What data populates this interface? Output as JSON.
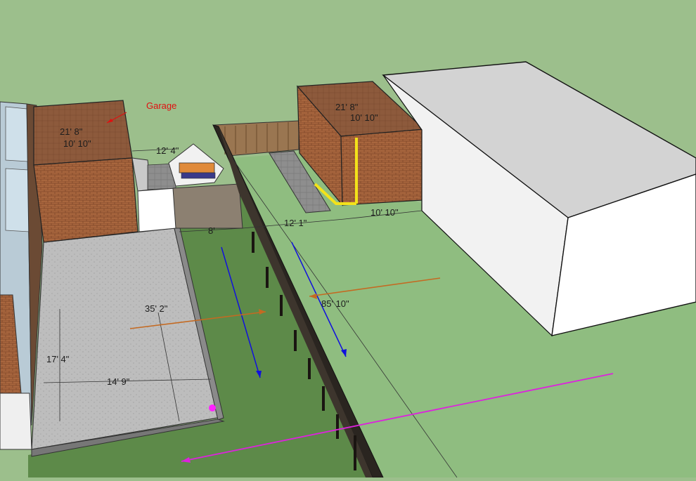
{
  "model": {
    "annotation": "Garage",
    "dimensions": {
      "garage_left_width": "21' 8\"",
      "garage_left_depth": "10' 10\"",
      "garage_right_width": "21' 8\"",
      "garage_right_depth": "10' 10\"",
      "gap_between": "12' 4\"",
      "side_path": "8'",
      "yard_width": "12' 1\"",
      "garage_right_front": "10' 10\"",
      "yard_length": "85' 10\"",
      "patio_length": "35' 2\"",
      "patio_depth": "17' 4\"",
      "patio_width": "14' 9\""
    }
  },
  "colors": {
    "sky_ground": "#9cbf8c",
    "lawn_dark": "#5d8a49",
    "lawn_light": "#8fbd80",
    "brick": "#a8663e",
    "roof_brown": "#8d5a3c",
    "building_top": "#d3d3d3",
    "building_side": "#f6f6f6",
    "arrow_blue": "#1010dd",
    "arrow_orange": "#c46a22",
    "arrow_magenta": "#dd22dd",
    "highlight_yellow": "#f3e21a"
  }
}
